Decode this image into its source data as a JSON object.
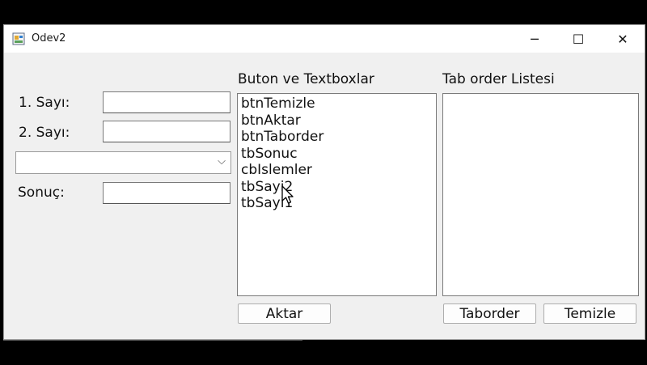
{
  "window": {
    "title": "Odev2",
    "minimize_glyph": "─",
    "maximize_glyph": "☐",
    "close_glyph": "✕"
  },
  "form": {
    "sayi1_label": "1. Sayı:",
    "sayi1_value": "",
    "sayi2_label": "2. Sayı:",
    "sayi2_value": "",
    "operation_selected": "",
    "sonuc_label": "Sonuç:",
    "sonuc_value": ""
  },
  "controls_list": {
    "heading": "Buton ve Textboxlar",
    "items": [
      "btnTemizle",
      "btnAktar",
      "btnTaborder",
      "tbSonuc",
      "cbIslemler",
      "tbSayi2",
      "tbSayi1"
    ]
  },
  "tab_order_list": {
    "heading": "Tab order Listesi",
    "items": []
  },
  "buttons": {
    "aktar": "Aktar",
    "taborder": "Taborder",
    "temizle": "Temizle"
  }
}
